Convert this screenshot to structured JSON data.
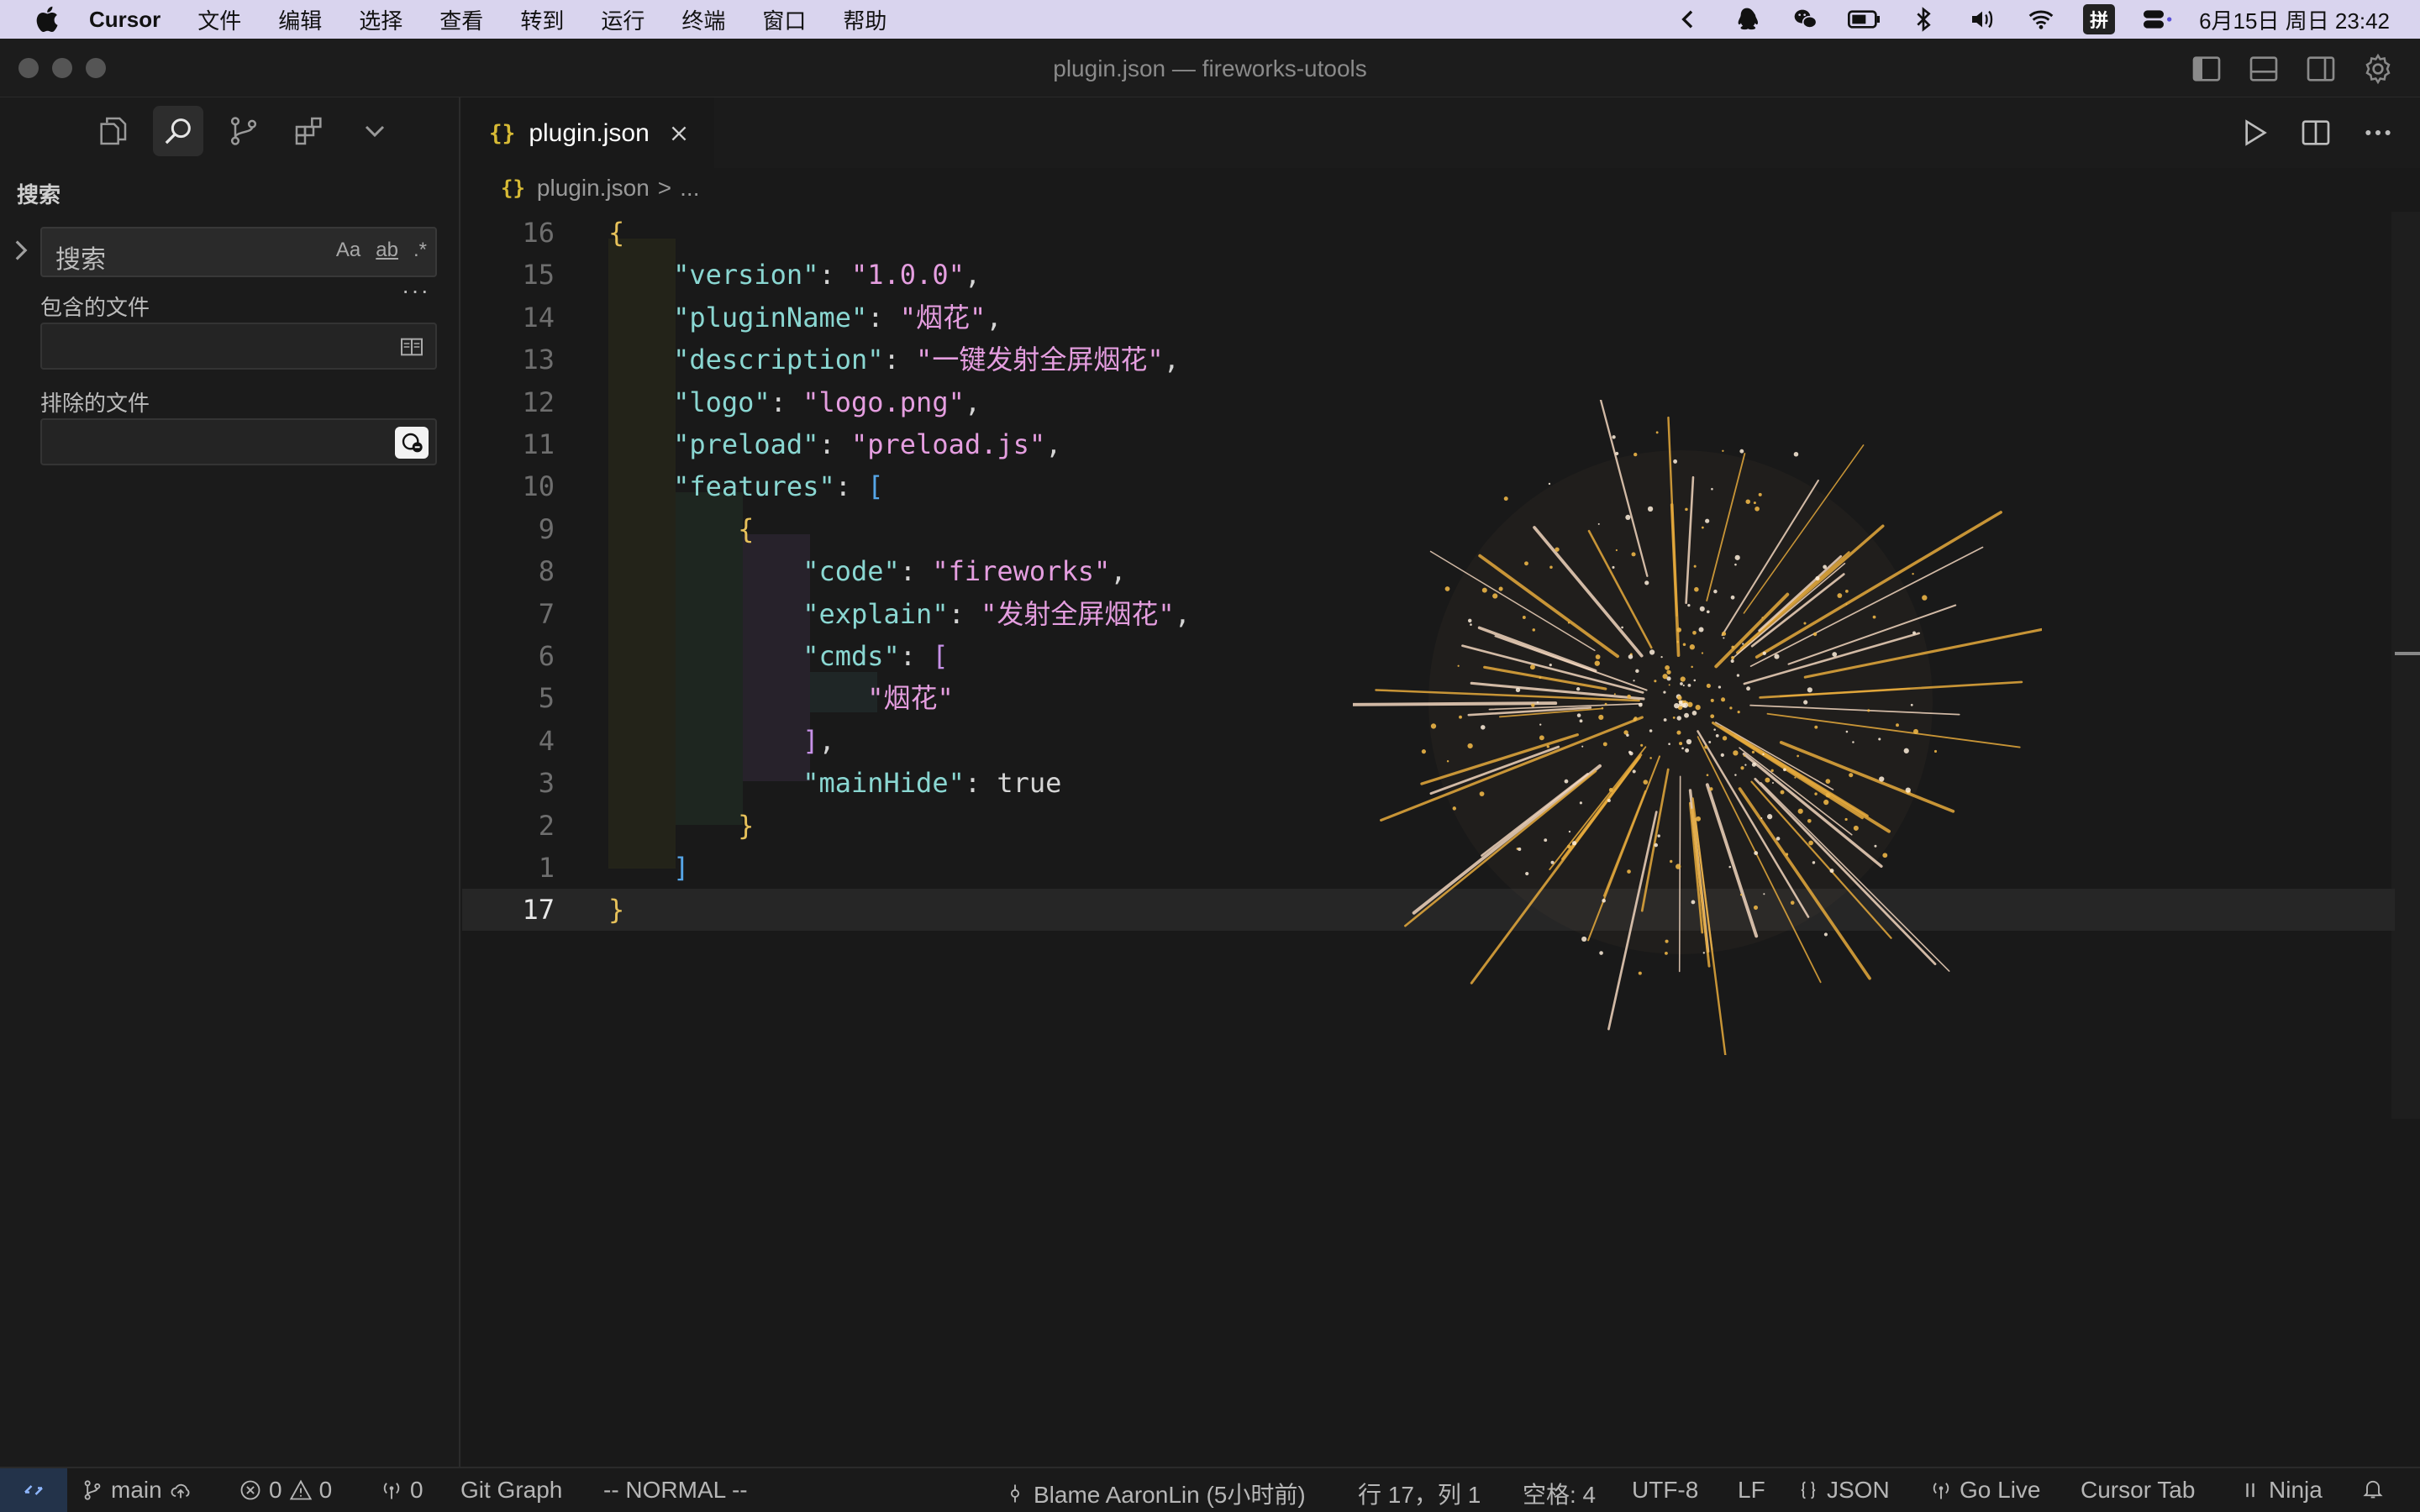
{
  "menubar": {
    "app": "Cursor",
    "items": [
      "文件",
      "编辑",
      "选择",
      "查看",
      "转到",
      "运行",
      "终端",
      "窗口",
      "帮助"
    ],
    "ime": "拼",
    "clock": "6月15日 周日 23:42"
  },
  "window": {
    "title": "plugin.json — fireworks-utools"
  },
  "sidebar": {
    "title": "搜索",
    "search_placeholder": "搜索",
    "search_opts": {
      "match_case": "Aa",
      "whole_word": "ab",
      "regex": ".*"
    },
    "more": "···",
    "include_label": "包含的文件",
    "exclude_label": "排除的文件"
  },
  "editor": {
    "tab": {
      "icon": "{}",
      "label": "plugin.json"
    },
    "breadcrumb": {
      "icon": "{}",
      "file": "plugin.json",
      "sep": ">",
      "rest": "..."
    },
    "lines": [
      {
        "n": "16",
        "parts": [
          [
            "br-y",
            "{"
          ]
        ]
      },
      {
        "n": "15",
        "parts": [
          [
            "k",
            "    \"version\""
          ],
          [
            "",
            ": "
          ],
          [
            "s",
            "\"1.0.0\""
          ],
          [
            "",
            ","
          ]
        ]
      },
      {
        "n": "14",
        "parts": [
          [
            "k",
            "    \"pluginName\""
          ],
          [
            "",
            ": "
          ],
          [
            "s",
            "\"烟花\""
          ],
          [
            "",
            ","
          ]
        ]
      },
      {
        "n": "13",
        "parts": [
          [
            "k",
            "    \"description\""
          ],
          [
            "",
            ": "
          ],
          [
            "s",
            "\"一键发射全屏烟花\""
          ],
          [
            "",
            ","
          ]
        ]
      },
      {
        "n": "12",
        "parts": [
          [
            "k",
            "    \"logo\""
          ],
          [
            "",
            ": "
          ],
          [
            "s",
            "\"logo.png\""
          ],
          [
            "",
            ","
          ]
        ]
      },
      {
        "n": "11",
        "parts": [
          [
            "k",
            "    \"preload\""
          ],
          [
            "",
            ": "
          ],
          [
            "s",
            "\"preload.js\""
          ],
          [
            "",
            ","
          ]
        ]
      },
      {
        "n": "10",
        "parts": [
          [
            "k",
            "    \"features\""
          ],
          [
            "",
            ": "
          ],
          [
            "br-b",
            "["
          ]
        ]
      },
      {
        "n": "9",
        "parts": [
          [
            "br-y",
            "        {"
          ]
        ]
      },
      {
        "n": "8",
        "parts": [
          [
            "k",
            "            \"code\""
          ],
          [
            "",
            ": "
          ],
          [
            "s",
            "\"fireworks\""
          ],
          [
            "",
            ","
          ]
        ]
      },
      {
        "n": "7",
        "parts": [
          [
            "k",
            "            \"explain\""
          ],
          [
            "",
            ": "
          ],
          [
            "s",
            "\"发射全屏烟花\""
          ],
          [
            "",
            ","
          ]
        ]
      },
      {
        "n": "6",
        "parts": [
          [
            "k",
            "            \"cmds\""
          ],
          [
            "",
            ": "
          ],
          [
            "br-p",
            "["
          ]
        ]
      },
      {
        "n": "5",
        "parts": [
          [
            "s",
            "                \"烟花\""
          ]
        ]
      },
      {
        "n": "4",
        "parts": [
          [
            "br-p",
            "            ]"
          ],
          [
            "",
            ","
          ]
        ]
      },
      {
        "n": "3",
        "parts": [
          [
            "k",
            "            \"mainHide\""
          ],
          [
            "",
            ": "
          ],
          [
            "",
            "true"
          ]
        ]
      },
      {
        "n": "2",
        "parts": [
          [
            "br-y",
            "        }"
          ]
        ]
      },
      {
        "n": "1",
        "parts": [
          [
            "br-b",
            "    ]"
          ]
        ]
      },
      {
        "n": "17",
        "parts": [
          [
            "br-y",
            "}"
          ]
        ],
        "current": true
      }
    ]
  },
  "statusbar": {
    "branch": "main",
    "errors": "0",
    "warnings": "0",
    "ports": "0",
    "git_graph": "Git Graph",
    "mode": "-- NORMAL --",
    "blame": "Blame AaronLin (5小时前)",
    "position": "行 17，列 1",
    "spaces": "空格: 4",
    "encoding": "UTF-8",
    "eol": "LF",
    "language": "JSON",
    "go_live": "Go Live",
    "cursor_tab": "Cursor Tab",
    "ninja": "Ninja"
  },
  "colors": {
    "key": "#8ad7d2",
    "string": "#e59ee0",
    "bracket_yellow": "#e6c15a",
    "bracket_purple": "#c791e8",
    "bracket_blue": "#56a6e8",
    "json_icon": "#d7ba35"
  }
}
